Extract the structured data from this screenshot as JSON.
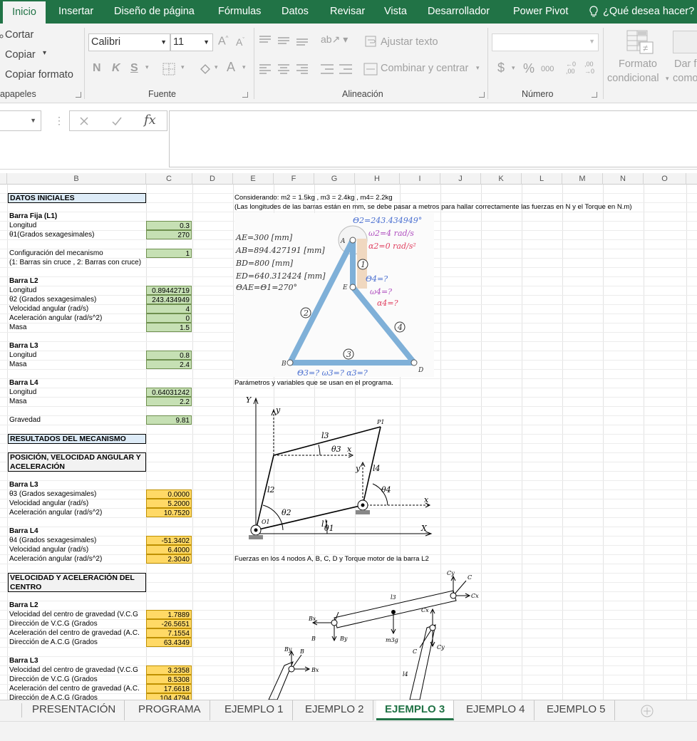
{
  "ribbon_tabs": [
    "Inicio",
    "Insertar",
    "Diseño de página",
    "Fórmulas",
    "Datos",
    "Revisar",
    "Vista",
    "Desarrollador",
    "Power Pivot",
    "¿Qué desea hacer?"
  ],
  "clipboard": {
    "cut": "Cortar",
    "copy": "Copiar",
    "format_painter": "Copiar formato",
    "group": "apapeles"
  },
  "font": {
    "name": "Calibri",
    "size": "11",
    "bold": "N",
    "italic": "K",
    "underline": "S",
    "color_letter": "A",
    "group": "Fuente"
  },
  "alignment": {
    "wrap": "Ajustar texto",
    "merge": "Combinar y centrar",
    "group": "Alineación"
  },
  "number": {
    "format_value": "",
    "currency": "$",
    "percent": "%",
    "thousands": "000",
    "inc_dec": ",00",
    "group": "Número"
  },
  "styles": {
    "cond_format_1": "Formato",
    "cond_format_2": "condicional",
    "table_1": "Dar f",
    "table_2": "como"
  },
  "formula_bar": {
    "name_box": "",
    "fx": "fx",
    "value": ""
  },
  "columns": [
    "B",
    "C",
    "D",
    "E",
    "F",
    "G",
    "H",
    "I",
    "J",
    "K",
    "L",
    "M",
    "N",
    "O"
  ],
  "cells": {
    "datos_iniciales": "DATOS INICIALES",
    "barra_fija": "Barra Fija (L1)",
    "l1_longitud": "Longitud",
    "l1_longitud_val": "0.3",
    "l1_theta": "θ1(Grados sexagesimales)",
    "l1_theta_val": "270",
    "config": "Configuración del mecanismo",
    "config_val": "1",
    "config_note": "(1: Barras sin cruce , 2: Barras con cruce)",
    "barra_l2": "Barra L2",
    "l2_longitud": "Longitud",
    "l2_longitud_val": "0.89442719",
    "l2_theta": "θ2 (Grados sexagesimales)",
    "l2_theta_val": "243.434949",
    "l2_vel": "Velocidad angular (rad/s)",
    "l2_vel_val": "4",
    "l2_acc": "Aceleración angular (rad/s^2)",
    "l2_acc_val": "0",
    "l2_masa": "Masa",
    "l2_masa_val": "1.5",
    "barra_l3": "Barra L3",
    "l3_longitud": "Longitud",
    "l3_longitud_val": "0.8",
    "l3_masa": "Masa",
    "l3_masa_val": "2.4",
    "barra_l4": "Barra L4",
    "l4_longitud": "Longitud",
    "l4_longitud_val": "0.64031242",
    "l4_masa": "Masa",
    "l4_masa_val": "2.2",
    "gravedad": "Gravedad",
    "gravedad_val": "9.81",
    "resultados": "RESULTADOS DEL MECANISMO",
    "pos_vel": "POSICIÓN, VELOCIDAD ANGULAR Y ACELERACIÓN",
    "r_barra_l3": "Barra L3",
    "r_l3_theta": "θ3 (Grados sexagesimales)",
    "r_l3_theta_val": "0.0000",
    "r_l3_vel": "Velocidad angular (rad/s)",
    "r_l3_vel_val": "5.2000",
    "r_l3_acc": "Aceleración angular (rad/s^2)",
    "r_l3_acc_val": "10.7520",
    "r_barra_l4": "Barra L4",
    "r_l4_theta": "θ4 (Grados sexagesimales)",
    "r_l4_theta_val": "-51.3402",
    "r_l4_vel": "Velocidad angular (rad/s)",
    "r_l4_vel_val": "6.4000",
    "r_l4_acc": "Aceleración angular (rad/s^2)",
    "r_l4_acc_val": "2.3040",
    "vel_acc_centro": "VELOCIDAD Y ACELERACIÓN DEL CENTRO",
    "c_barra_l2": "Barra L2",
    "c_l2_vcg": "Velocidad del centro de gravedad (V.C.G",
    "c_l2_vcg_val": "1.7889",
    "c_l2_dvcg": "Dirección de V.C.G (Grados",
    "c_l2_dvcg_val": "-26.5651",
    "c_l2_acg": "Aceleración del centro de gravedad (A.C.",
    "c_l2_acg_val": "7.1554",
    "c_l2_dacg": "Dirección de A.C.G (Grados",
    "c_l2_dacg_val": "63.4349",
    "c_barra_l3": "Barra L3",
    "c_l3_vcg": "Velocidad del centro de gravedad (V.C.G",
    "c_l3_vcg_val": "3.2358",
    "c_l3_dvcg": "Dirección de V.C.G (Grados",
    "c_l3_dvcg_val": "8.5308",
    "c_l3_acg": "Aceleración del centro de gravedad (A.C.",
    "c_l3_acg_val": "17.6618",
    "c_l3_dacg": "Dirección de A.C.G (Grados",
    "c_l3_dacg_val": "104.4794"
  },
  "notes": {
    "considerando": "Considerando: m2 = 1.5kg , m3 = 2.4kg , m4= 2.2kg",
    "longitudes": "(Las longitudes de las barras están en mm, se debe pasar a metros para hallar correctamente las fuerzas en N y el Torque en N.m)",
    "parametros": "Parámetros y variables que se usan en el programa.",
    "fuerzas": "Fuerzas en los 4 nodos A, B, C, D y Torque motor de la barra L2"
  },
  "diagram1": {
    "ae": "AE=300  [mm]",
    "ab": "AB=894.427191  [mm]",
    "bd": "BD=800  [mm]",
    "ed": "ED=640.312424  [mm]",
    "theta_ae": "ΘAE=Θ1=270°",
    "theta2": "Θ2=243.434949°",
    "omega2": "ω2=4  rad/s",
    "alpha2": "α2=0  rad/s²",
    "theta4": "Θ4=?",
    "omega4": "ω4=?",
    "alpha4": "α4=?",
    "bottom": "Θ3=?  ω3=?  α3=?",
    "nA": "A",
    "nB": "B",
    "nD": "D",
    "nE": "E",
    "n1": "1",
    "n2": "2",
    "n3": "3",
    "n4": "4"
  },
  "diagram2": {
    "Y": "Y",
    "X": "X",
    "y": "y",
    "x": "x",
    "l1": "l1",
    "l2": "l2",
    "l3": "l3",
    "l4": "l4",
    "t1": "θ1",
    "t2": "θ2",
    "t3": "θ3",
    "t4": "θ4",
    "P1": "P1",
    "O1": "O1"
  },
  "diagram3": {
    "l3": "l3",
    "l4": "l4",
    "m3g": "m3g",
    "B": "B",
    "Bx": "Bx",
    "By": "By",
    "C": "C",
    "Cx": "Cx",
    "Cy": "Cy"
  },
  "sheets": [
    "PRESENTACIÓN",
    "PROGRAMA",
    "EJEMPLO 1",
    "EJEMPLO 2",
    "EJEMPLO 3",
    "EJEMPLO 4",
    "EJEMPLO 5"
  ],
  "active_sheet": "EJEMPLO 3",
  "colors": {
    "accent": "#217346",
    "input_green": "#c6e0b4",
    "output_orange": "#ffd966",
    "header_blue": "#ddebf7"
  }
}
